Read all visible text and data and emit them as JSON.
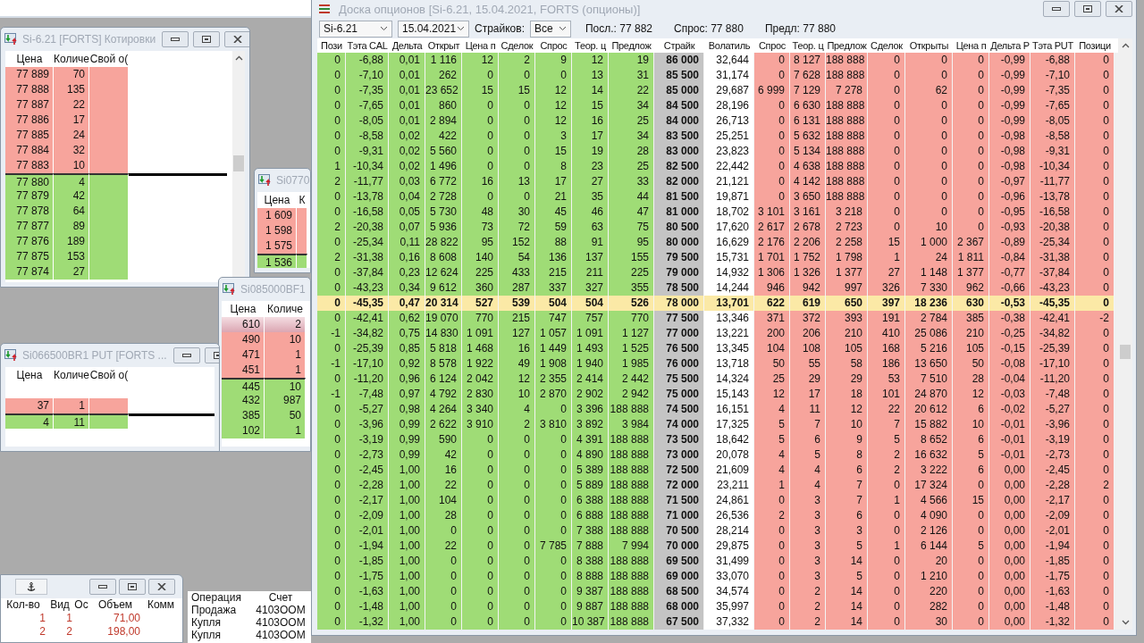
{
  "quote_windows": [
    {
      "title": "Si-6.21 [FORTS] Котировки",
      "columns": [
        "Цена",
        "Количе",
        "Свой о("
      ],
      "rows": [
        {
          "kind": "ask",
          "price": "77 889",
          "qty": "70"
        },
        {
          "kind": "ask",
          "price": "77 888",
          "qty": "135"
        },
        {
          "kind": "ask",
          "price": "77 887",
          "qty": "22"
        },
        {
          "kind": "ask",
          "price": "77 886",
          "qty": "17"
        },
        {
          "kind": "ask",
          "price": "77 885",
          "qty": "24"
        },
        {
          "kind": "ask",
          "price": "77 884",
          "qty": "32"
        },
        {
          "kind": "ask",
          "price": "77 883",
          "qty": "10"
        },
        {
          "kind": "bid",
          "price": "77 880",
          "qty": "4"
        },
        {
          "kind": "bid",
          "price": "77 879",
          "qty": "42"
        },
        {
          "kind": "bid",
          "price": "77 878",
          "qty": "64"
        },
        {
          "kind": "bid",
          "price": "77 877",
          "qty": "89"
        },
        {
          "kind": "bid",
          "price": "77 876",
          "qty": "189"
        },
        {
          "kind": "bid",
          "price": "77 875",
          "qty": "153"
        },
        {
          "kind": "bid",
          "price": "77 874",
          "qty": "27"
        }
      ]
    },
    {
      "title": "Si0770",
      "columns": [
        "Цена",
        "К"
      ],
      "rows": [
        {
          "kind": "ask",
          "price": "1 609"
        },
        {
          "kind": "ask",
          "price": "1 598"
        },
        {
          "kind": "ask",
          "price": "1 575"
        },
        {
          "kind": "bid",
          "price": "1 536"
        }
      ]
    },
    {
      "title": "Si085000BF1",
      "columns": [
        "Цена",
        "Количе"
      ],
      "rows": [
        {
          "kind": "ask",
          "selected": true,
          "price": "610",
          "qty": "2"
        },
        {
          "kind": "ask",
          "selected": false,
          "price": "490",
          "qty": "10"
        },
        {
          "kind": "ask",
          "selected": false,
          "price": "471",
          "qty": "1"
        },
        {
          "kind": "ask",
          "selected": false,
          "price": "451",
          "qty": "1"
        },
        {
          "kind": "bid",
          "selected": false,
          "price": "445",
          "qty": "10"
        },
        {
          "kind": "bid",
          "selected": false,
          "price": "432",
          "qty": "987"
        },
        {
          "kind": "bid",
          "selected": false,
          "price": "385",
          "qty": "50"
        },
        {
          "kind": "bid",
          "selected": false,
          "price": "102",
          "qty": "1"
        }
      ]
    },
    {
      "title": "Si066500BR1 PUT [FORTS ...",
      "columns": [
        "Цена",
        "Количе",
        "Свой о("
      ],
      "rows": [
        {
          "kind": "empty"
        },
        {
          "kind": "ask",
          "price": "37",
          "qty": "1"
        },
        {
          "kind": "bid",
          "price": "4",
          "qty": "11"
        }
      ]
    }
  ],
  "trades": {
    "columns": [
      "Кол-во",
      "Вид",
      "Ос",
      "Объем",
      "Комм"
    ],
    "rows": [
      {
        "qty": "1",
        "type": "1",
        "volume": "71,00"
      },
      {
        "qty": "2",
        "type": "2",
        "volume": "198,00"
      }
    ]
  },
  "operations": {
    "columns": [
      "Операция",
      "Счет"
    ],
    "rows": [
      [
        "Продажа",
        "4103OOM"
      ],
      [
        "Купля",
        "4103OOM"
      ],
      [
        "Купля",
        "4103OOM"
      ]
    ]
  },
  "board": {
    "title": "Доска опционов [Si-6.21, 15.04.2021, FORTS (опционы)]",
    "instrument": "Si-6.21",
    "expiry": "15.04.2021",
    "strikes_label": "Страйков:",
    "strikes_value": "Все",
    "last": "Посл.: 77 882",
    "bid": "Спрос: 77 880",
    "ask": "Предл: 77 880",
    "columns": [
      {
        "label": "Пози",
        "kind": "call"
      },
      {
        "label": "Тэта CAL",
        "kind": "call"
      },
      {
        "label": "Дельта",
        "kind": "call"
      },
      {
        "label": "Открыт",
        "kind": "call"
      },
      {
        "label": "Цена п",
        "kind": "call"
      },
      {
        "label": "Сделок",
        "kind": "call"
      },
      {
        "label": "Спрос",
        "kind": "call"
      },
      {
        "label": "Теор. ц",
        "kind": "call"
      },
      {
        "label": "Предлож",
        "kind": "call"
      },
      {
        "label": "Страйк",
        "kind": "strike"
      },
      {
        "label": "Волатиль",
        "kind": "vol"
      },
      {
        "label": "Спрос",
        "kind": "put"
      },
      {
        "label": "Теор. ц",
        "kind": "put"
      },
      {
        "label": "Предлож",
        "kind": "put"
      },
      {
        "label": "Сделок",
        "kind": "put"
      },
      {
        "label": "Открыты",
        "kind": "put"
      },
      {
        "label": "Цена п",
        "kind": "put"
      },
      {
        "label": "Дельта Р",
        "kind": "put"
      },
      {
        "label": "Тэта PUT",
        "kind": "put"
      },
      {
        "label": "Позици",
        "kind": "put"
      }
    ],
    "rows": [
      {
        "central": false,
        "cells": [
          "0",
          "-6,88",
          "0,01",
          "1 116",
          "12",
          "2",
          "9",
          "12",
          "19",
          "86 000",
          "32,644",
          "0",
          "8 127",
          "188 888",
          "0",
          "0",
          "0",
          "-0,99",
          "-6,88",
          "0"
        ]
      },
      {
        "central": false,
        "cells": [
          "0",
          "-7,10",
          "0,01",
          "262",
          "0",
          "0",
          "0",
          "13",
          "31",
          "85 500",
          "31,174",
          "0",
          "7 628",
          "188 888",
          "0",
          "0",
          "0",
          "-0,99",
          "-7,10",
          "0"
        ]
      },
      {
        "central": false,
        "cells": [
          "0",
          "-7,35",
          "0,01",
          "23 652",
          "15",
          "15",
          "12",
          "14",
          "22",
          "85 000",
          "29,687",
          "6 999",
          "7 129",
          "7 278",
          "0",
          "62",
          "0",
          "-0,99",
          "-7,35",
          "0"
        ]
      },
      {
        "central": false,
        "cells": [
          "0",
          "-7,65",
          "0,01",
          "860",
          "0",
          "0",
          "12",
          "15",
          "34",
          "84 500",
          "28,196",
          "0",
          "6 630",
          "188 888",
          "0",
          "0",
          "0",
          "-0,99",
          "-7,65",
          "0"
        ]
      },
      {
        "central": false,
        "cells": [
          "0",
          "-8,05",
          "0,01",
          "2 894",
          "0",
          "0",
          "12",
          "16",
          "25",
          "84 000",
          "26,713",
          "0",
          "6 131",
          "188 888",
          "0",
          "0",
          "0",
          "-0,99",
          "-8,05",
          "0"
        ]
      },
      {
        "central": false,
        "cells": [
          "0",
          "-8,58",
          "0,02",
          "422",
          "0",
          "0",
          "3",
          "17",
          "34",
          "83 500",
          "25,251",
          "0",
          "5 632",
          "188 888",
          "0",
          "0",
          "0",
          "-0,98",
          "-8,58",
          "0"
        ]
      },
      {
        "central": false,
        "cells": [
          "0",
          "-9,31",
          "0,02",
          "5 560",
          "0",
          "0",
          "15",
          "19",
          "28",
          "83 000",
          "23,823",
          "0",
          "5 134",
          "188 888",
          "0",
          "0",
          "0",
          "-0,98",
          "-9,31",
          "0"
        ]
      },
      {
        "central": false,
        "cells": [
          "1",
          "-10,34",
          "0,02",
          "1 496",
          "0",
          "0",
          "8",
          "23",
          "25",
          "82 500",
          "22,442",
          "0",
          "4 638",
          "188 888",
          "0",
          "0",
          "0",
          "-0,98",
          "-10,34",
          "0"
        ]
      },
      {
        "central": false,
        "cells": [
          "2",
          "-11,77",
          "0,03",
          "6 772",
          "16",
          "13",
          "17",
          "27",
          "33",
          "82 000",
          "21,121",
          "0",
          "4 142",
          "188 888",
          "0",
          "0",
          "0",
          "-0,97",
          "-11,77",
          "0"
        ]
      },
      {
        "central": false,
        "cells": [
          "0",
          "-13,78",
          "0,04",
          "2 728",
          "0",
          "0",
          "21",
          "35",
          "44",
          "81 500",
          "19,871",
          "0",
          "3 650",
          "188 888",
          "0",
          "0",
          "0",
          "-0,96",
          "-13,78",
          "0"
        ]
      },
      {
        "central": false,
        "cells": [
          "0",
          "-16,58",
          "0,05",
          "5 730",
          "48",
          "30",
          "45",
          "46",
          "47",
          "81 000",
          "18,702",
          "3 101",
          "3 161",
          "3 218",
          "0",
          "0",
          "0",
          "-0,95",
          "-16,58",
          "0"
        ]
      },
      {
        "central": false,
        "cells": [
          "2",
          "-20,38",
          "0,07",
          "5 936",
          "73",
          "72",
          "59",
          "63",
          "75",
          "80 500",
          "17,620",
          "2 617",
          "2 678",
          "2 723",
          "0",
          "10",
          "0",
          "-0,93",
          "-20,38",
          "0"
        ]
      },
      {
        "central": false,
        "cells": [
          "0",
          "-25,34",
          "0,11",
          "28 822",
          "95",
          "152",
          "88",
          "91",
          "95",
          "80 000",
          "16,629",
          "2 176",
          "2 206",
          "2 258",
          "15",
          "1 000",
          "2 367",
          "-0,89",
          "-25,34",
          "0"
        ]
      },
      {
        "central": false,
        "cells": [
          "2",
          "-31,38",
          "0,16",
          "8 608",
          "140",
          "54",
          "136",
          "137",
          "155",
          "79 500",
          "15,731",
          "1 701",
          "1 752",
          "1 798",
          "1",
          "24",
          "1 811",
          "-0,84",
          "-31,38",
          "0"
        ]
      },
      {
        "central": false,
        "cells": [
          "0",
          "-37,84",
          "0,23",
          "12 624",
          "225",
          "433",
          "215",
          "211",
          "225",
          "79 000",
          "14,932",
          "1 306",
          "1 326",
          "1 377",
          "27",
          "1 148",
          "1 377",
          "-0,77",
          "-37,84",
          "0"
        ]
      },
      {
        "central": false,
        "cells": [
          "0",
          "-43,23",
          "0,34",
          "9 612",
          "360",
          "287",
          "337",
          "327",
          "355",
          "78 500",
          "14,244",
          "946",
          "942",
          "997",
          "326",
          "7 330",
          "962",
          "-0,66",
          "-43,23",
          "0"
        ]
      },
      {
        "central": true,
        "cells": [
          "0",
          "-45,35",
          "0,47",
          "20 314",
          "527",
          "539",
          "504",
          "504",
          "526",
          "78 000",
          "13,701",
          "622",
          "619",
          "650",
          "397",
          "18 236",
          "630",
          "-0,53",
          "-45,35",
          "0"
        ]
      },
      {
        "central": false,
        "cells": [
          "0",
          "-42,41",
          "0,62",
          "19 070",
          "770",
          "215",
          "747",
          "757",
          "770",
          "77 500",
          "13,346",
          "371",
          "372",
          "393",
          "191",
          "2 784",
          "385",
          "-0,38",
          "-42,41",
          "-2"
        ]
      },
      {
        "central": false,
        "cells": [
          "-1",
          "-34,82",
          "0,75",
          "14 830",
          "1 091",
          "127",
          "1 057",
          "1 091",
          "1 127",
          "77 000",
          "13,221",
          "200",
          "206",
          "210",
          "410",
          "25 086",
          "210",
          "-0,25",
          "-34,82",
          "0"
        ]
      },
      {
        "central": false,
        "cells": [
          "0",
          "-25,39",
          "0,85",
          "5 818",
          "1 468",
          "16",
          "1 449",
          "1 493",
          "1 525",
          "76 500",
          "13,345",
          "104",
          "108",
          "105",
          "168",
          "5 216",
          "105",
          "-0,15",
          "-25,39",
          "0"
        ]
      },
      {
        "central": false,
        "cells": [
          "-1",
          "-17,10",
          "0,92",
          "8 578",
          "1 922",
          "49",
          "1 908",
          "1 940",
          "1 985",
          "76 000",
          "13,718",
          "50",
          "55",
          "58",
          "186",
          "13 650",
          "50",
          "-0,08",
          "-17,10",
          "0"
        ]
      },
      {
        "central": false,
        "cells": [
          "0",
          "-11,20",
          "0,96",
          "6 124",
          "2 042",
          "12",
          "2 355",
          "2 414",
          "2 442",
          "75 500",
          "14,324",
          "25",
          "29",
          "29",
          "53",
          "7 510",
          "28",
          "-0,04",
          "-11,20",
          "0"
        ]
      },
      {
        "central": false,
        "cells": [
          "-1",
          "-7,48",
          "0,97",
          "4 792",
          "2 830",
          "10",
          "2 870",
          "2 902",
          "2 942",
          "75 000",
          "15,143",
          "12",
          "17",
          "18",
          "101",
          "24 870",
          "12",
          "-0,03",
          "-7,48",
          "0"
        ]
      },
      {
        "central": false,
        "cells": [
          "0",
          "-5,27",
          "0,98",
          "4 264",
          "3 340",
          "4",
          "0",
          "3 396",
          "188 888",
          "74 500",
          "16,151",
          "4",
          "11",
          "12",
          "22",
          "20 612",
          "6",
          "-0,02",
          "-5,27",
          "0"
        ]
      },
      {
        "central": false,
        "cells": [
          "0",
          "-3,96",
          "0,99",
          "2 622",
          "3 910",
          "2",
          "3 810",
          "3 892",
          "3 984",
          "74 000",
          "17,325",
          "5",
          "7",
          "10",
          "7",
          "15 882",
          "10",
          "-0,01",
          "-3,96",
          "0"
        ]
      },
      {
        "central": false,
        "cells": [
          "0",
          "-3,19",
          "0,99",
          "590",
          "0",
          "0",
          "0",
          "4 391",
          "188 888",
          "73 500",
          "18,642",
          "5",
          "6",
          "9",
          "5",
          "8 652",
          "6",
          "-0,01",
          "-3,19",
          "0"
        ]
      },
      {
        "central": false,
        "cells": [
          "0",
          "-2,73",
          "0,99",
          "42",
          "0",
          "0",
          "0",
          "4 890",
          "188 888",
          "73 000",
          "20,078",
          "4",
          "5",
          "8",
          "2",
          "16 632",
          "5",
          "-0,01",
          "-2,73",
          "0"
        ]
      },
      {
        "central": false,
        "cells": [
          "0",
          "-2,45",
          "1,00",
          "16",
          "0",
          "0",
          "0",
          "5 389",
          "188 888",
          "72 500",
          "21,609",
          "4",
          "4",
          "6",
          "2",
          "3 222",
          "6",
          "0,00",
          "-2,45",
          "0"
        ]
      },
      {
        "central": false,
        "cells": [
          "0",
          "-2,28",
          "1,00",
          "22",
          "0",
          "0",
          "0",
          "5 889",
          "188 888",
          "72 000",
          "23,211",
          "1",
          "4",
          "7",
          "0",
          "17 324",
          "0",
          "0,00",
          "-2,28",
          "2"
        ]
      },
      {
        "central": false,
        "cells": [
          "0",
          "-2,17",
          "1,00",
          "104",
          "0",
          "0",
          "0",
          "6 388",
          "188 888",
          "71 500",
          "24,861",
          "0",
          "3",
          "7",
          "1",
          "4 566",
          "15",
          "0,00",
          "-2,17",
          "0"
        ]
      },
      {
        "central": false,
        "cells": [
          "0",
          "-2,09",
          "1,00",
          "28",
          "0",
          "0",
          "0",
          "6 888",
          "188 888",
          "71 000",
          "26,536",
          "2",
          "3",
          "6",
          "0",
          "4 090",
          "0",
          "0,00",
          "-2,09",
          "0"
        ]
      },
      {
        "central": false,
        "cells": [
          "0",
          "-2,01",
          "1,00",
          "0",
          "0",
          "0",
          "0",
          "7 388",
          "188 888",
          "70 500",
          "28,214",
          "0",
          "3",
          "3",
          "0",
          "2 126",
          "0",
          "0,00",
          "-2,01",
          "0"
        ]
      },
      {
        "central": false,
        "cells": [
          "0",
          "-1,94",
          "1,00",
          "22",
          "0",
          "0",
          "7 785",
          "7 888",
          "7 994",
          "70 000",
          "29,875",
          "0",
          "3",
          "5",
          "1",
          "6 144",
          "5",
          "0,00",
          "-1,94",
          "0"
        ]
      },
      {
        "central": false,
        "cells": [
          "0",
          "-1,85",
          "1,00",
          "0",
          "0",
          "0",
          "0",
          "8 388",
          "188 888",
          "69 500",
          "31,499",
          "0",
          "3",
          "14",
          "0",
          "20",
          "0",
          "0,00",
          "-1,85",
          "0"
        ]
      },
      {
        "central": false,
        "cells": [
          "0",
          "-1,75",
          "1,00",
          "0",
          "0",
          "0",
          "0",
          "8 888",
          "188 888",
          "69 000",
          "33,070",
          "0",
          "3",
          "5",
          "0",
          "1 210",
          "0",
          "0,00",
          "-1,75",
          "0"
        ]
      },
      {
        "central": false,
        "cells": [
          "0",
          "-1,63",
          "1,00",
          "0",
          "0",
          "0",
          "0",
          "9 387",
          "188 888",
          "68 500",
          "34,574",
          "0",
          "2",
          "14",
          "0",
          "220",
          "0",
          "0,00",
          "-1,63",
          "0"
        ]
      },
      {
        "central": false,
        "cells": [
          "0",
          "-1,48",
          "1,00",
          "0",
          "0",
          "0",
          "0",
          "9 887",
          "188 888",
          "68 000",
          "35,997",
          "0",
          "2",
          "14",
          "0",
          "282",
          "0",
          "0,00",
          "-1,48",
          "0"
        ]
      },
      {
        "central": false,
        "cells": [
          "0",
          "-1,32",
          "1,00",
          "0",
          "0",
          "0",
          "0",
          "10 387",
          "188 888",
          "67 500",
          "37,332",
          "0",
          "2",
          "14",
          "0",
          "30",
          "0",
          "0,00",
          "-1,32",
          "0"
        ]
      }
    ]
  }
}
